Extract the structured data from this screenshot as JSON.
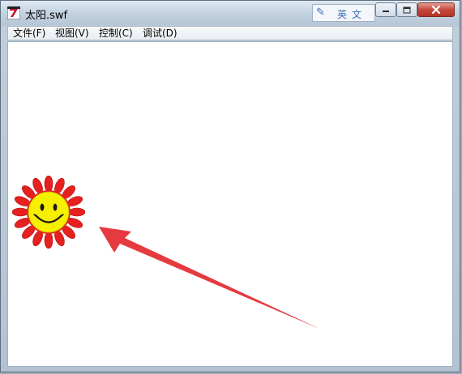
{
  "window": {
    "title": "太阳.swf"
  },
  "ime": {
    "label": "英文"
  },
  "menu": {
    "items": [
      "文件(F)",
      "视图(V)",
      "控制(C)",
      "调试(D)"
    ]
  },
  "colors": {
    "sun_petals": "#e5201f",
    "sun_face": "#f7ef00",
    "arrow": "#e53a3f",
    "close_button": "#c6473a"
  },
  "icons": {
    "app": "flash-player-icon",
    "ime": "ime-logo-icon",
    "minimize": "minimize-icon",
    "maximize": "maximize-icon",
    "close": "close-icon"
  }
}
